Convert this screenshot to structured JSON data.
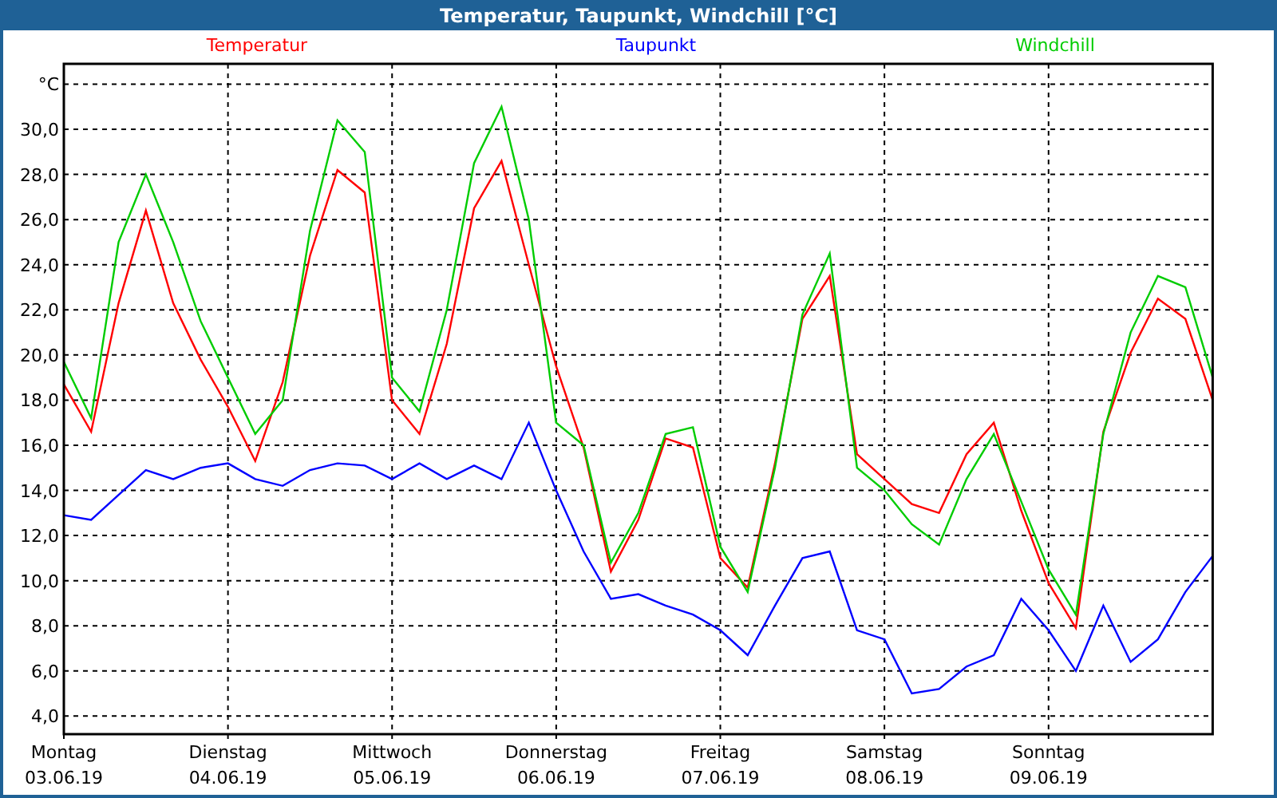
{
  "window": {
    "title": "Temperatur, Taupunkt, Windchill [°C]"
  },
  "chart": {
    "dates": [
      "03.06.19",
      "04.06.19",
      "05.06.19",
      "06.06.19",
      "07.06.19",
      "08.06.19",
      "09.06.19"
    ],
    "chart_data": {
      "type": "line",
      "grid": true,
      "ylim": [
        3.2,
        32.9
      ],
      "categories": [
        "Montag",
        null,
        null,
        null,
        null,
        null,
        "Dienstag",
        null,
        null,
        null,
        null,
        null,
        "Mittwoch",
        null,
        null,
        null,
        null,
        null,
        "Donnerstag",
        null,
        null,
        null,
        null,
        null,
        "Freitag",
        null,
        null,
        null,
        null,
        null,
        "Samstag",
        null,
        null,
        null,
        null,
        null,
        "Sonntag",
        null,
        null,
        null,
        null,
        null,
        null
      ],
      "yticks": [
        {
          "value": 4,
          "label": "4,0"
        },
        {
          "value": 6,
          "label": "6,0"
        },
        {
          "value": 8,
          "label": "8,0"
        },
        {
          "value": 10,
          "label": "10,0"
        },
        {
          "value": 12,
          "label": "12,0"
        },
        {
          "value": 14,
          "label": "14,0"
        },
        {
          "value": 16,
          "label": "16,0"
        },
        {
          "value": 18,
          "label": "18,0"
        },
        {
          "value": 20,
          "label": "20,0"
        },
        {
          "value": 22,
          "label": "22,0"
        },
        {
          "value": 24,
          "label": "24,0"
        },
        {
          "value": 26,
          "label": "26,0"
        },
        {
          "value": 28,
          "label": "28,0"
        },
        {
          "value": 30,
          "label": "30,0"
        },
        {
          "value": 32,
          "label": "°C"
        }
      ],
      "series": [
        {
          "name": "Temperatur",
          "color": "#ff0000",
          "values": [
            18.7,
            16.6,
            22.3,
            26.4,
            22.3,
            19.8,
            17.7,
            15.3,
            18.8,
            24.4,
            28.2,
            27.2,
            18.0,
            16.5,
            20.5,
            26.5,
            28.6,
            24.0,
            19.5,
            15.9,
            10.4,
            12.7,
            16.3,
            15.9,
            11.0,
            9.7,
            15.2,
            21.6,
            23.5,
            15.6,
            14.5,
            13.4,
            13.0,
            15.6,
            17.0,
            13.1,
            9.9,
            7.9,
            16.6,
            20.1,
            22.5,
            21.6,
            18.0
          ]
        },
        {
          "name": "Taupunkt",
          "color": "#0000ff",
          "values": [
            12.9,
            12.7,
            13.8,
            14.9,
            14.5,
            15.0,
            15.2,
            14.5,
            14.2,
            14.9,
            15.2,
            15.1,
            14.5,
            15.2,
            14.5,
            15.1,
            14.5,
            17.0,
            14.0,
            11.3,
            9.2,
            9.4,
            8.9,
            8.5,
            7.8,
            6.7,
            8.9,
            11.0,
            11.3,
            7.8,
            7.4,
            5.0,
            5.2,
            6.2,
            6.7,
            9.2,
            7.8,
            6.0,
            8.9,
            6.4,
            7.4,
            9.5,
            11.1
          ]
        },
        {
          "name": "Windchill",
          "color": "#00cc00",
          "values": [
            19.7,
            17.2,
            25.0,
            28.0,
            25.0,
            21.5,
            19.0,
            16.5,
            18.0,
            25.5,
            30.4,
            29.0,
            19.0,
            17.5,
            22.0,
            28.5,
            31.0,
            26.0,
            17.0,
            16.0,
            10.8,
            13.0,
            16.5,
            16.8,
            11.5,
            9.5,
            15.0,
            21.8,
            24.5,
            15.0,
            14.0,
            12.5,
            11.6,
            14.5,
            16.5,
            13.5,
            10.5,
            8.5,
            16.5,
            21.0,
            23.5,
            23.0,
            19.0
          ]
        }
      ]
    }
  }
}
